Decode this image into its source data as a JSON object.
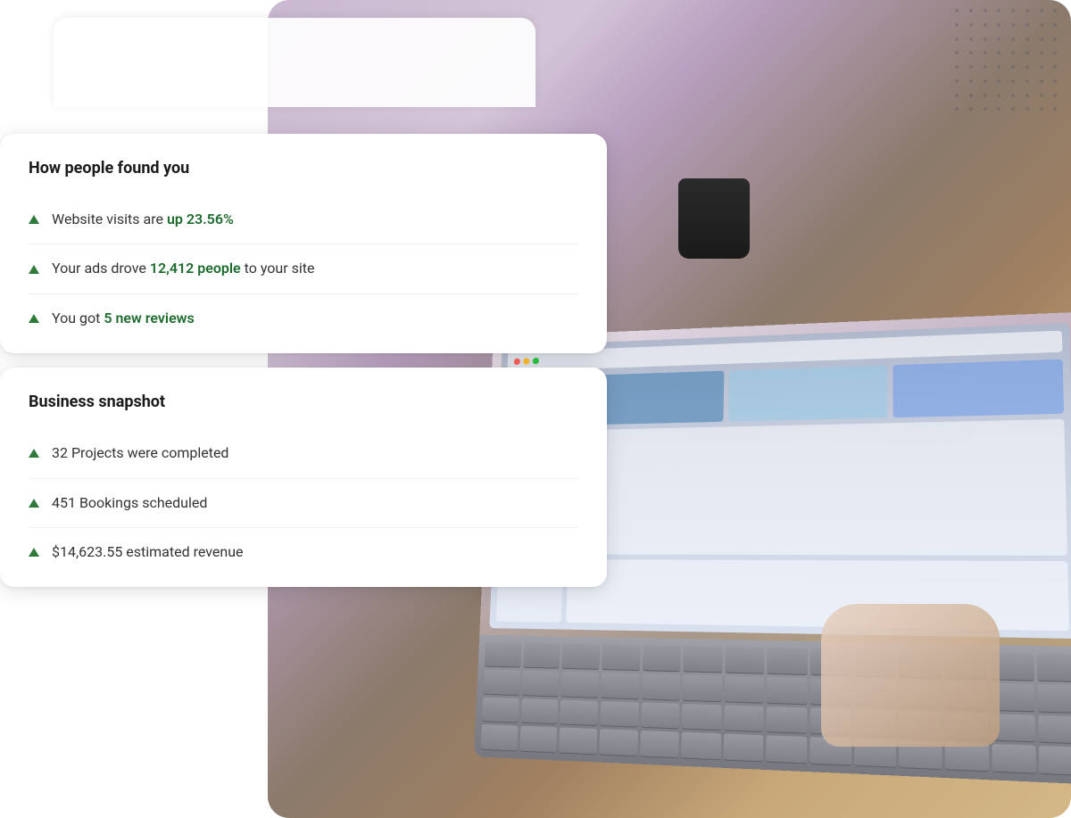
{
  "background": {
    "description": "Person using laptop with coffee cup on wooden table"
  },
  "card1": {
    "title": "How people found you",
    "items": [
      {
        "text_before": "Website visits are ",
        "highlight": "up 23.56%",
        "text_after": ""
      },
      {
        "text_before": "Your ads drove ",
        "highlight": "12,412 people",
        "text_after": " to your site"
      },
      {
        "text_before": "You got ",
        "highlight": "5 new reviews",
        "text_after": ""
      }
    ]
  },
  "card2": {
    "title": "Business snapshot",
    "items": [
      {
        "text_before": "32 Projects were completed",
        "highlight": "",
        "text_after": ""
      },
      {
        "text_before": "451 Bookings scheduled",
        "highlight": "",
        "text_after": ""
      },
      {
        "text_before": "$14,623.55 estimated revenue",
        "highlight": "",
        "text_after": ""
      }
    ]
  },
  "dots": {
    "count": 64,
    "color": "rgba(80,80,100,0.3)"
  }
}
